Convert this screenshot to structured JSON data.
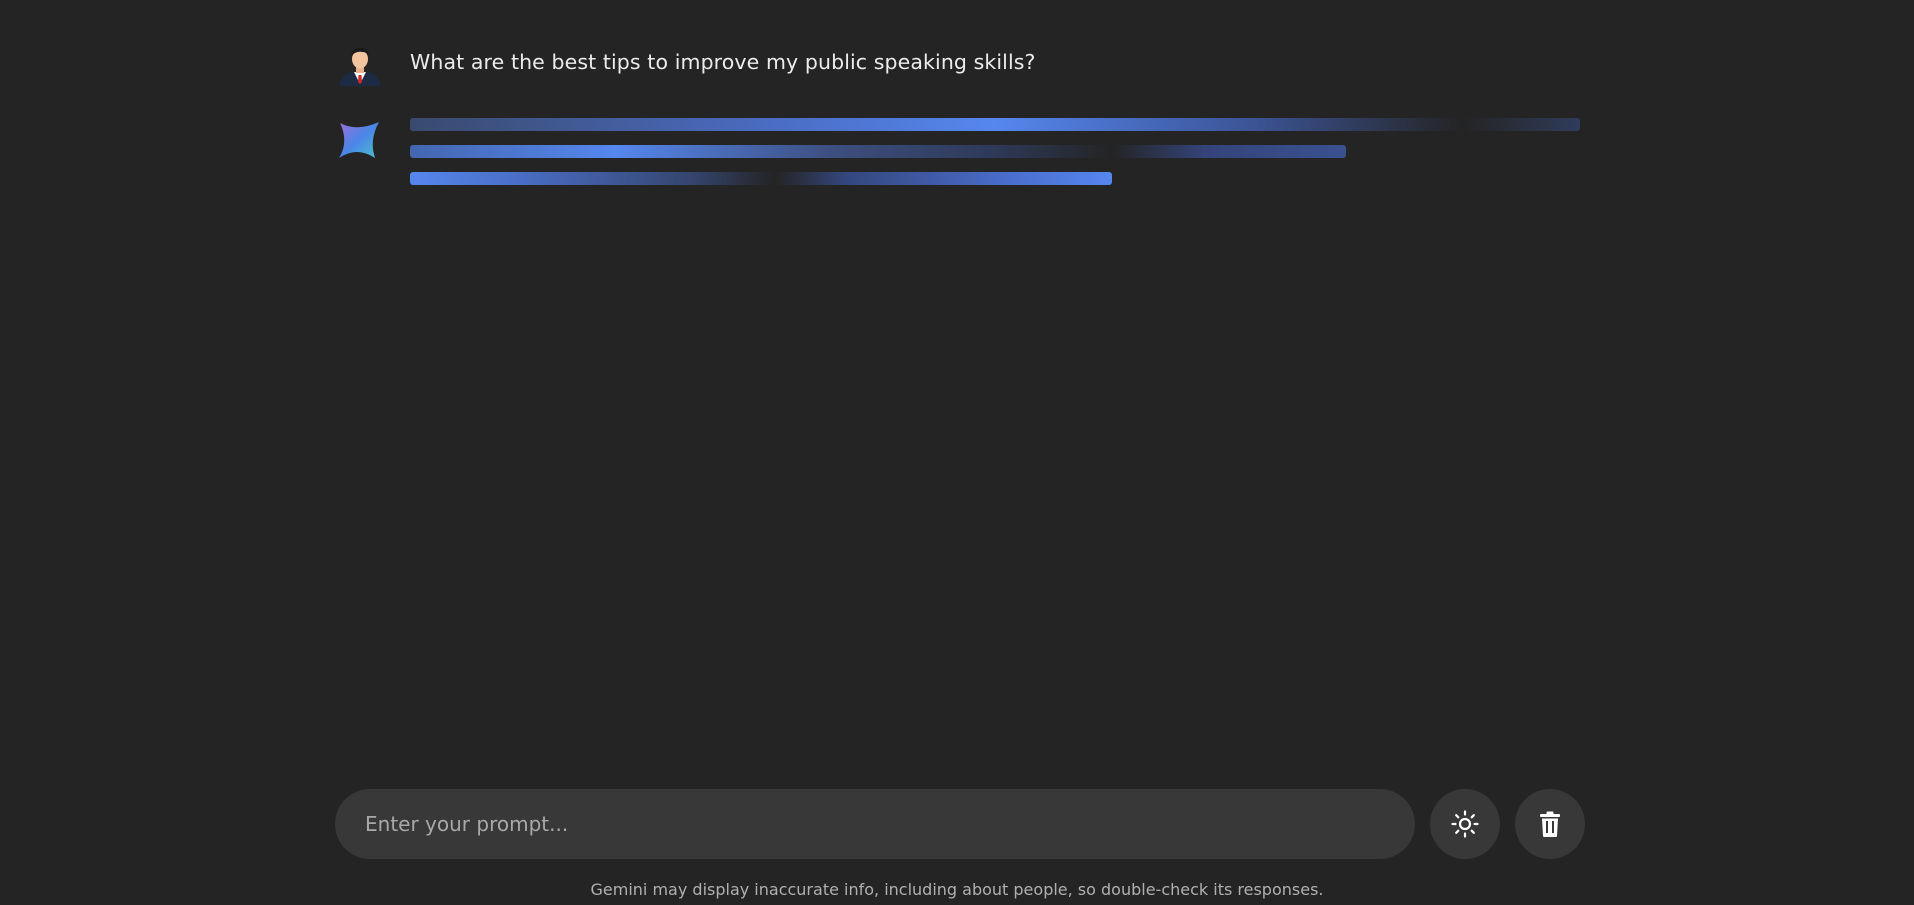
{
  "chat": {
    "user_message": "What are the best tips to improve my public speaking skills?"
  },
  "composer": {
    "placeholder": "Enter your prompt...",
    "theme_icon": "sun-icon",
    "delete_icon": "trash-icon"
  },
  "footer": {
    "disclaimer": "Gemini may display inaccurate info, including about people, so double-check its responses."
  },
  "colors": {
    "background": "#242424",
    "input_background": "#383838",
    "loading_accent": "#5587ee"
  }
}
